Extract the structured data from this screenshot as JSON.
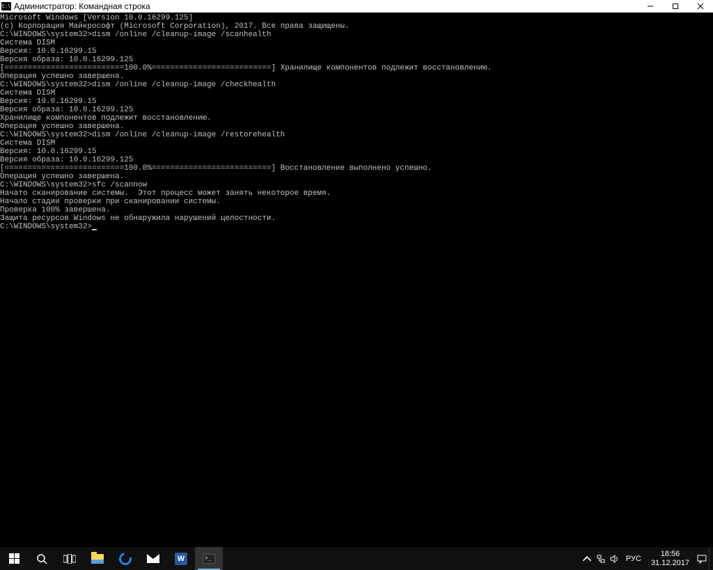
{
  "titlebar": {
    "icon_text": "C:\\",
    "title": "Администратор: Командная строка"
  },
  "console": {
    "lines": [
      "Microsoft Windows [Version 10.0.16299.125]",
      "(c) Корпорация Майкрософт (Microsoft Corporation), 2017. Все права защищены.",
      "",
      "C:\\WINDOWS\\system32>dism /online /cleanup-image /scanhealth",
      "",
      "Cистема DISM",
      "Версия: 10.0.16299.15",
      "",
      "Версия образа: 10.0.16299.125",
      "",
      "[==========================100.0%==========================] Хранилище компонентов подлежит восстановлению.",
      "Операция успешно завершена.",
      "",
      "C:\\WINDOWS\\system32>dism /online /cleanup-image /checkhealth",
      "",
      "Cистема DISM",
      "Версия: 10.0.16299.15",
      "",
      "Версия образа: 10.0.16299.125",
      "",
      "Хранилище компонентов подлежит восстановлению.",
      "Операция успешно завершена.",
      "",
      "C:\\WINDOWS\\system32>dism /online /cleanup-image /restorehealth",
      "",
      "Cистема DISM",
      "Версия: 10.0.16299.15",
      "",
      "Версия образа: 10.0.16299.125",
      "",
      "[==========================100.0%==========================] Восстановление выполнено успешно.",
      "Операция успешно завершена.",
      "",
      "C:\\WINDOWS\\system32>sfc /scannow",
      "",
      "Начато сканирование системы.  Этот процесс может занять некоторое время.",
      "",
      "Начало стадии проверки при сканировании системы.",
      "Проверка 100% завершена.",
      "",
      "Защита ресурсов Windows не обнаружила нарушений целостности.",
      "",
      "C:\\WINDOWS\\system32>"
    ]
  },
  "taskbar": {
    "word_letter": "W",
    "lang": "РУС",
    "time": "18:56",
    "date": "31.12.2017"
  }
}
